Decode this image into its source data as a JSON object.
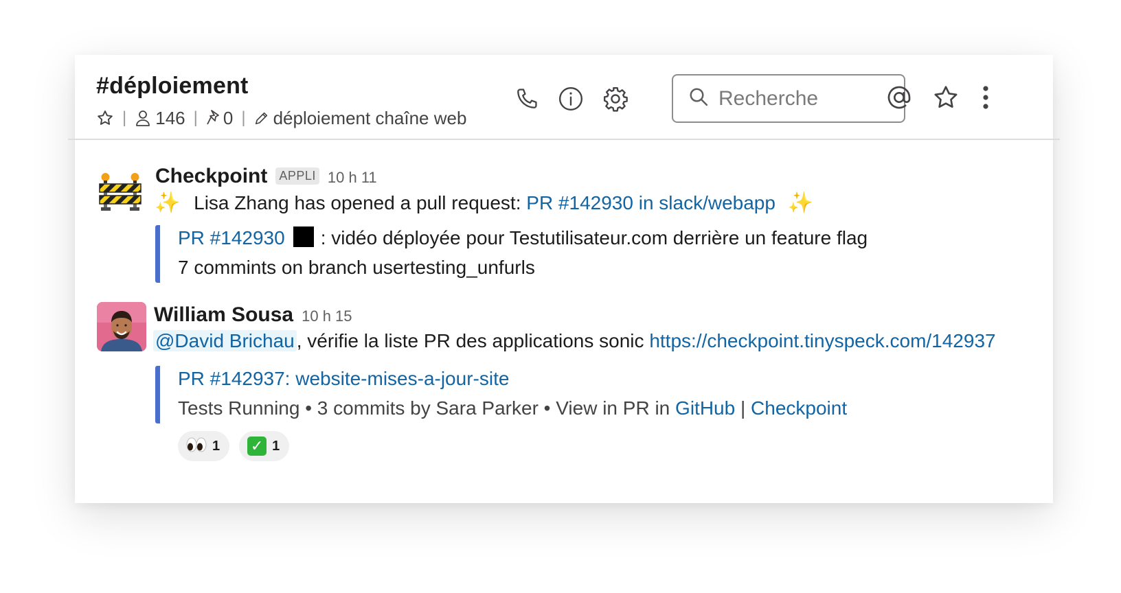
{
  "channel": {
    "name": "#déploiement",
    "member_count": "146",
    "pinned_count": "0",
    "topic": "déploiement chaîne web"
  },
  "header": {
    "search_placeholder": "Recherche",
    "icons": [
      "phone-icon",
      "info-icon",
      "gear-icon",
      "search-icon",
      "at-icon",
      "star-icon",
      "more-icon"
    ]
  },
  "messages": [
    {
      "sender": "Checkpoint",
      "badge": "APPLI",
      "time": "10 h 11",
      "text_prefix": "Lisa Zhang has opened a pull request: ",
      "text_link": "PR #142930 in slack/webapp",
      "attachment": {
        "title_link": "PR #142930",
        "title_rest": ": vidéo déployée pour Testutilisateur.com derrière un feature flag",
        "subtitle": "7 commints on branch usertesting_unfurls"
      }
    },
    {
      "sender": "William Sousa",
      "time": "10 h 15",
      "mention": "@David Brichau",
      "text_middle": ", vérifie la liste PR des applications sonic ",
      "text_link": "https://checkpoint.tinyspeck.com/142937",
      "attachment": {
        "title_link": "PR #142937: website-mises-a-jour-site",
        "meta_text": "Tests Running • 3 commits by Sara Parker • View in PR in ",
        "meta_link_1": "GitHub",
        "meta_sep": " | ",
        "meta_link_2": "Checkpoint"
      },
      "reactions": [
        {
          "emoji": "👀",
          "count": "1"
        },
        {
          "emoji": "✅",
          "count": "1"
        }
      ]
    }
  ],
  "colors": {
    "link": "#1264a3",
    "attachment_bar": "#4a6ec9",
    "mention_bg": "#e8f5fa"
  }
}
